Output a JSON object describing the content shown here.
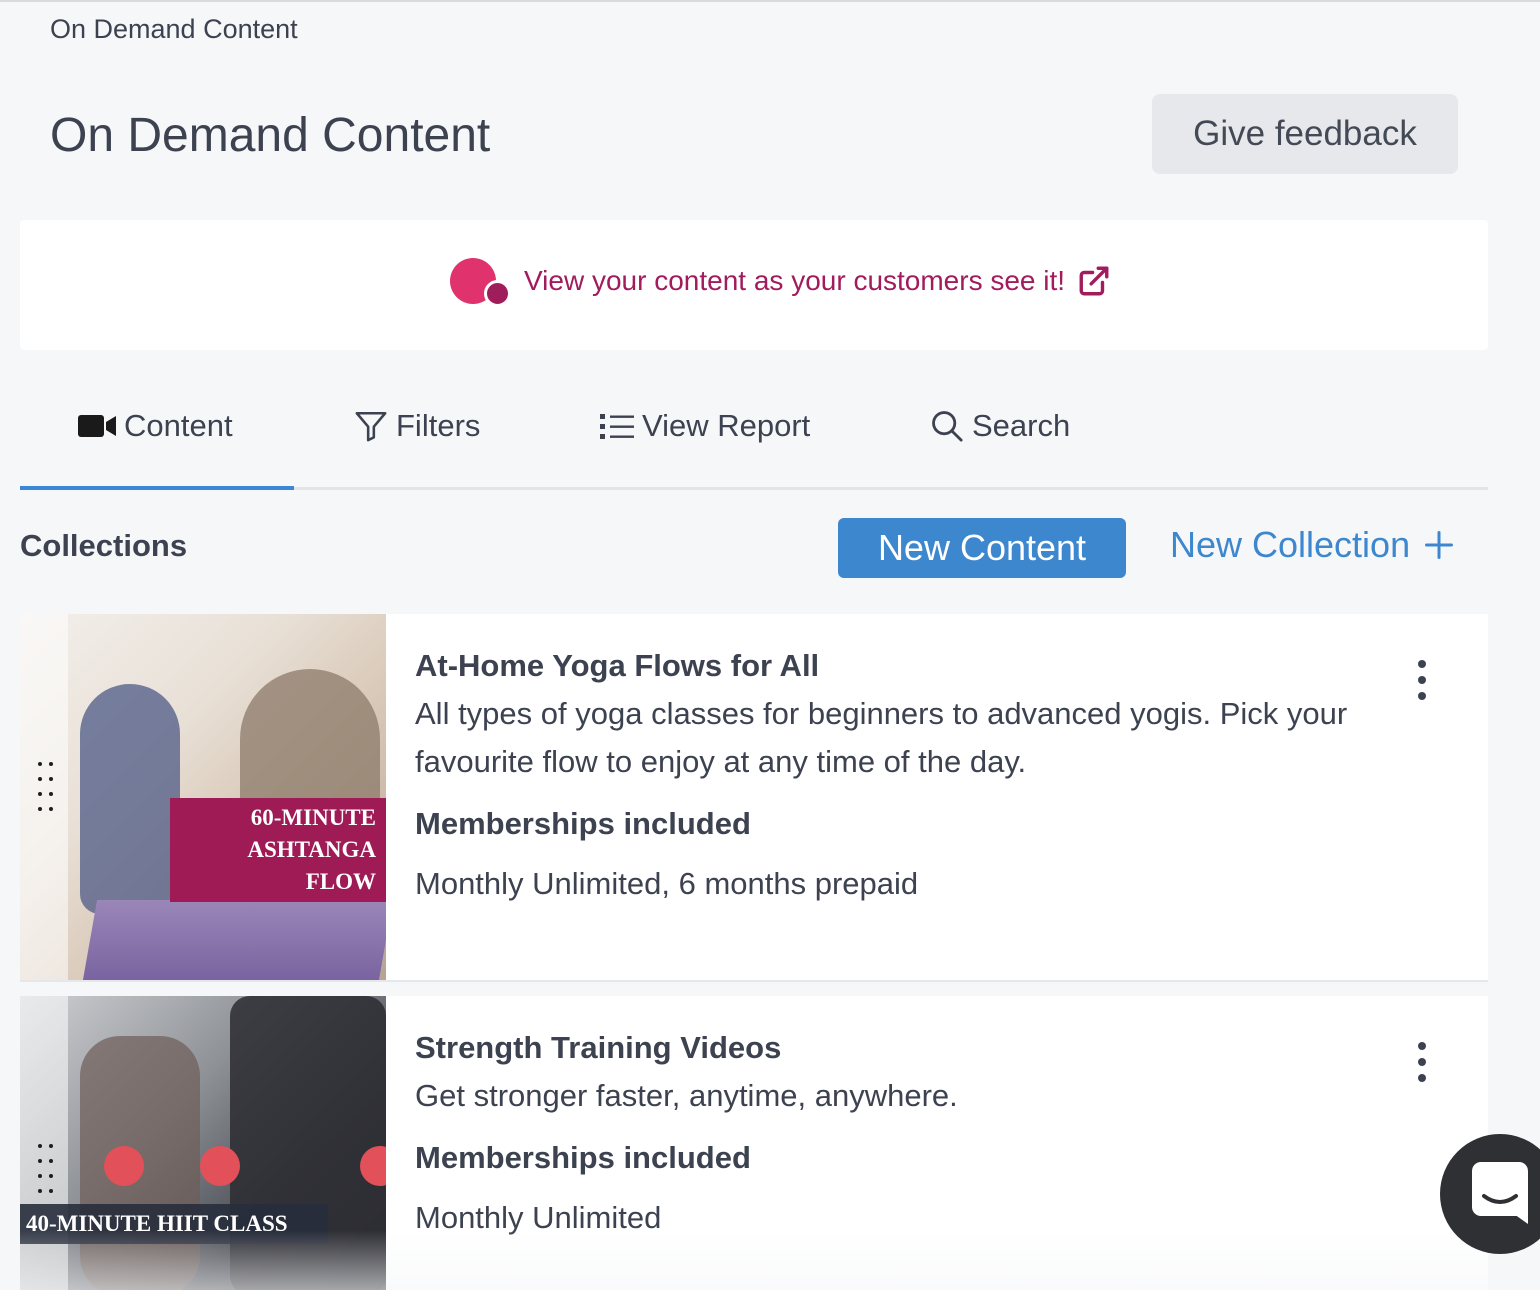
{
  "breadcrumb": "On Demand Content",
  "page_title": "On Demand Content",
  "feedback_label": "Give feedback",
  "preview": {
    "link_text": "View your content as your customers see it!",
    "brand_color": "#e0336d",
    "accent_color": "#a11b5d"
  },
  "tabs": [
    {
      "label": "Content",
      "icon": "video-camera-icon",
      "active": true
    },
    {
      "label": "Filters",
      "icon": "filter-icon",
      "active": false
    },
    {
      "label": "View Report",
      "icon": "list-icon",
      "active": false
    },
    {
      "label": "Search",
      "icon": "search-icon",
      "active": false
    }
  ],
  "collections": {
    "heading": "Collections",
    "new_content_label": "New Content",
    "new_collection_label": "New Collection",
    "items": [
      {
        "thumbnail_label_line1": "60-MINUTE",
        "thumbnail_label_line2": "ASHTANGA FLOW",
        "title": "At-Home Yoga Flows for All",
        "description": "All types of yoga classes for beginners to advanced yogis. Pick your favourite flow to enjoy at any time of the day.",
        "memberships_heading": "Memberships included",
        "memberships": "Monthly Unlimited, 6 months prepaid"
      },
      {
        "thumbnail_label_line1": "40-MINUTE HIIT CLASS",
        "title": "Strength Training Videos",
        "description": "Get stronger faster, anytime, anywhere.",
        "memberships_heading": "Memberships included",
        "memberships": "Monthly Unlimited"
      }
    ]
  },
  "colors": {
    "primary": "#3d87cf",
    "active_tab_bar": "#3b87d6"
  }
}
